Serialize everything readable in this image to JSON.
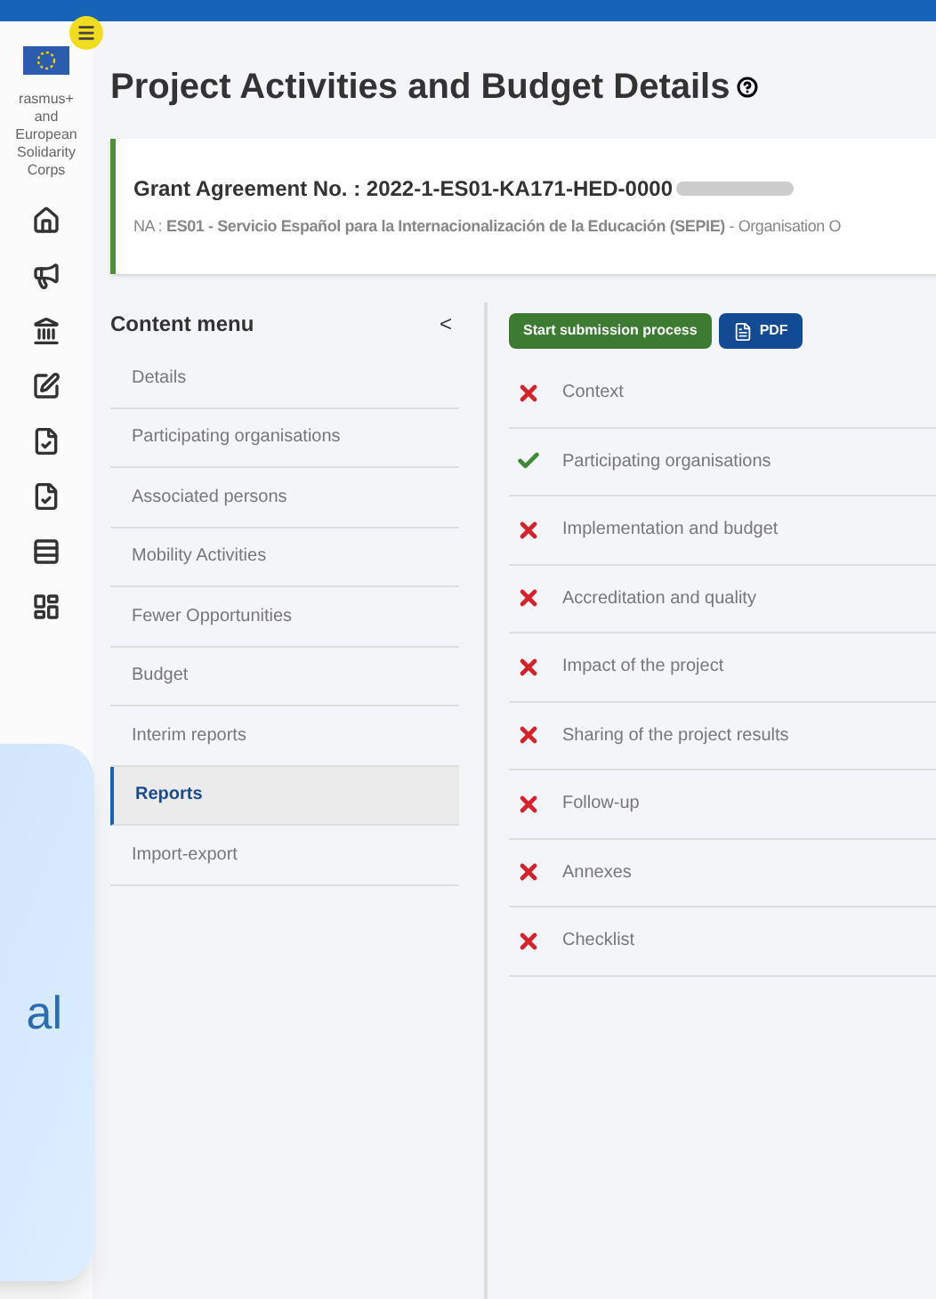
{
  "brand": {
    "text": "rasmus+ and European Solidarity Corps"
  },
  "page": {
    "title": "Project Activities and Budget Details"
  },
  "grant": {
    "label": "Grant Agreement No. : 2022-1-ES01-KA171-HED-0000",
    "na": "NA : **ES01 - Servicio Español para la Internacionalización de la Educación (SEPIE)** - Organisation O"
  },
  "content_menu": {
    "title": "Content menu",
    "collapse": "<",
    "items": [
      {
        "label": "Details",
        "selected": false
      },
      {
        "label": "Participating organisations",
        "selected": false
      },
      {
        "label": "Associated persons",
        "selected": false
      },
      {
        "label": "Mobility Activities",
        "selected": false
      },
      {
        "label": "Fewer Opportunities",
        "selected": false
      },
      {
        "label": "Budget",
        "selected": false
      },
      {
        "label": "Interim reports",
        "selected": false
      },
      {
        "label": "Reports",
        "selected": true
      },
      {
        "label": "Import-export",
        "selected": false
      }
    ]
  },
  "actions": {
    "submit": "Start submission process",
    "pdf": "PDF"
  },
  "sections": [
    {
      "label": "Context",
      "complete": false
    },
    {
      "label": "Participating organisations",
      "complete": true
    },
    {
      "label": "Implementation and budget",
      "complete": false
    },
    {
      "label": "Accreditation and quality",
      "complete": false
    },
    {
      "label": "Impact of the project",
      "complete": false
    },
    {
      "label": "Sharing of the project results",
      "complete": false
    },
    {
      "label": "Follow-up",
      "complete": false
    },
    {
      "label": "Annexes",
      "complete": false
    },
    {
      "label": "Checklist",
      "complete": false
    }
  ],
  "overlay": {
    "text": "al"
  }
}
